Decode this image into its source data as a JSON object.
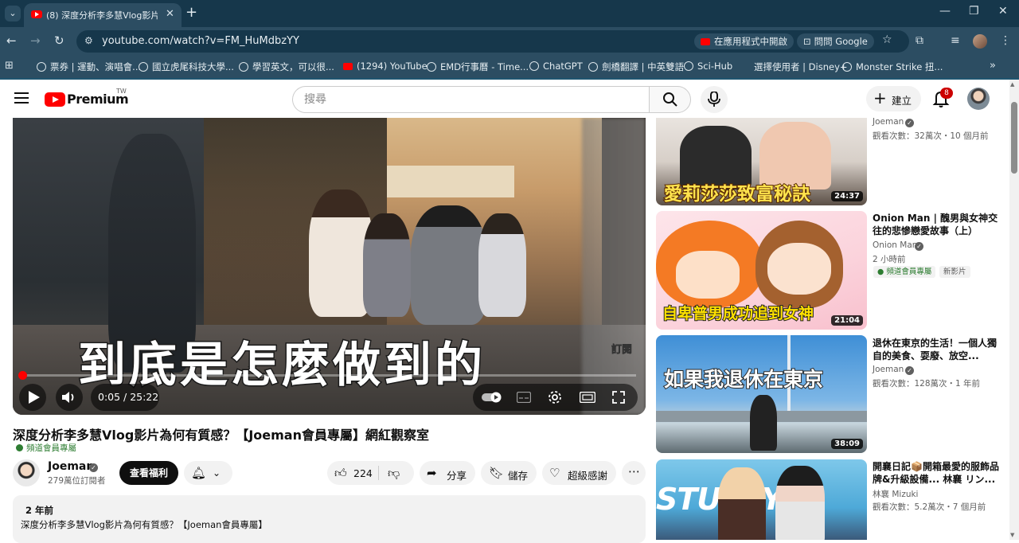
{
  "browser": {
    "tab_title": "(8) 深度分析李多慧Vlog影片為",
    "url": "youtube.com/watch?v=FM_HuMdbzYY",
    "open_in_app": "在應用程式中開啟",
    "ask_google": "問問 Google",
    "bookmarks": [
      "票券 | 運動、演唱會...",
      "國立虎尾科技大學...",
      "學習英文，可以很...",
      "(1294) YouTube",
      "EMD行事曆 - Time...",
      "ChatGPT",
      "劍橋翻譯 | 中英雙語",
      "Sci-Hub",
      "選擇使用者 | Disney+",
      "Monster Strike 扭..."
    ]
  },
  "masthead": {
    "logo_text": "Premium",
    "region": "TW",
    "search_placeholder": "搜尋",
    "create_label": "建立",
    "notification_count": "8"
  },
  "player": {
    "subtitle": "到底是怎麼做到的",
    "corner_label": "訂閱",
    "current_time": "0:05",
    "duration": "25:22",
    "time_display": "0:05 / 25:22",
    "progress": 0.003
  },
  "video": {
    "title": "深度分析李多慧Vlog影片為何有質感？【Joeman會員專屬】網紅觀察室",
    "members_badge": "頻道會員專屬",
    "channel": "Joeman",
    "subscribers": "279萬位訂閱者",
    "join_label": "查看福利",
    "likes": "224",
    "share_label": "分享",
    "save_label": "儲存",
    "thanks_label": "超級感謝",
    "description_age": "2 年前",
    "description_line": "深度分析李多慧Vlog影片為何有質感？【Joeman會員專屬】"
  },
  "recommendations": [
    {
      "title": "",
      "channel": "Joeman",
      "meta": "觀看次數：32萬次・10 個月前",
      "duration": "24:37",
      "caption": "愛莉莎莎致富秘訣"
    },
    {
      "title": "Onion Man | 醜男與女神交往的悲慘戀愛故事（上）",
      "channel": "Onion Man",
      "meta": "2 小時前",
      "members_tag": "頻道會員專屬",
      "new_tag": "新影片",
      "duration": "21:04",
      "caption": "自卑普男成功追到女神"
    },
    {
      "title": "退休在東京的生活！一個人獨自的美食、耍廢、放空...",
      "channel": "Joeman",
      "meta": "觀看次數：128萬次・1 年前",
      "duration": "38:09",
      "caption": "如果我退休在東京"
    },
    {
      "title": "開襄日記📦開箱最愛的服飾品牌&升級設備... 林襄 リン...",
      "channel": "林襄 Mizuki",
      "meta": "觀看次數：5.2萬次・7 個月前",
      "caption": "STUSSY"
    }
  ]
}
